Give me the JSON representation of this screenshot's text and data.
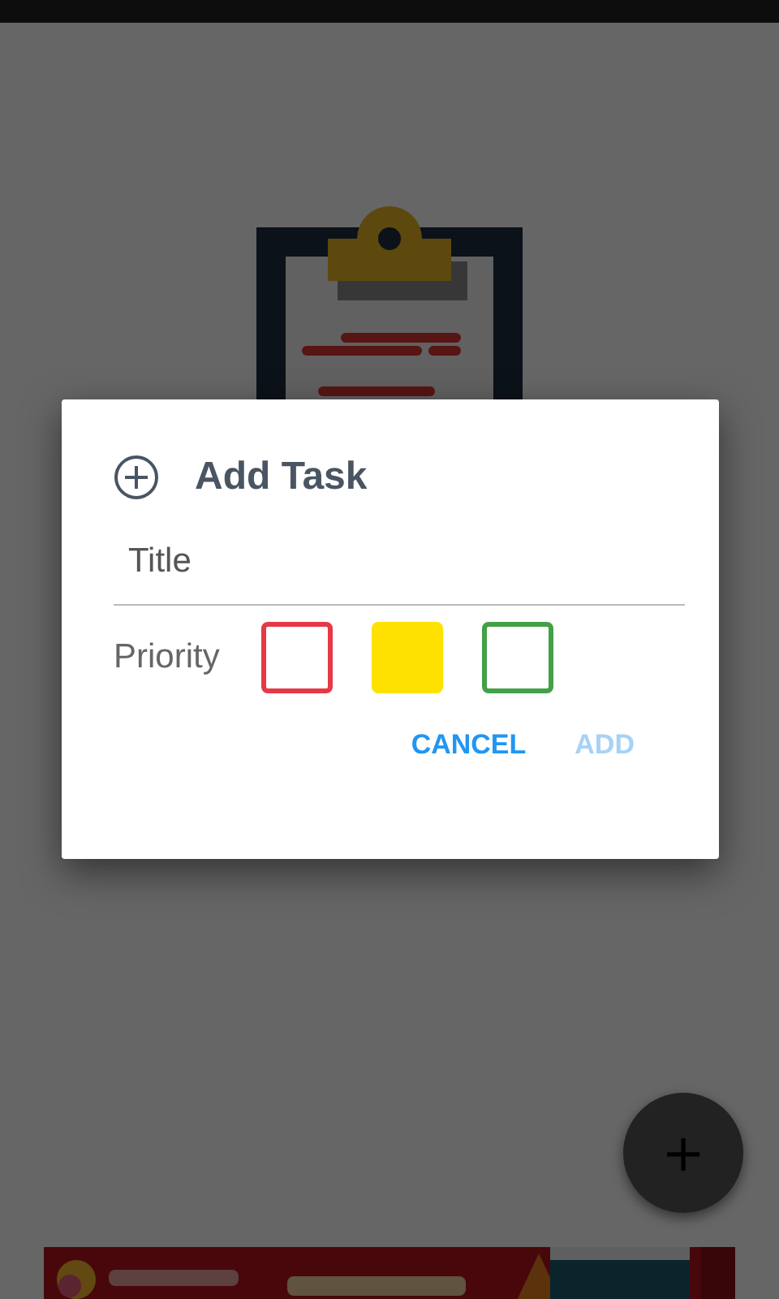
{
  "dialog": {
    "title": "Add Task",
    "title_field": {
      "placeholder": "Title"
    },
    "priority": {
      "label": "Priority",
      "options": [
        {
          "color": "#e53945",
          "selected": false
        },
        {
          "color": "#ffe100",
          "selected": true
        },
        {
          "color": "#43a047",
          "selected": false
        }
      ]
    },
    "buttons": [
      {
        "label": "CANCEL",
        "disabled": false
      },
      {
        "label": "ADD",
        "disabled": true
      }
    ]
  },
  "fab": {
    "label": "+"
  }
}
